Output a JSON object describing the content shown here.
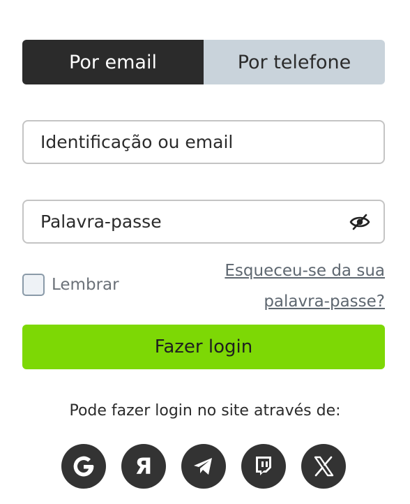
{
  "tabs": {
    "email_label": "Por email",
    "phone_label": "Por telefone"
  },
  "form": {
    "username_placeholder": "Identificação ou email",
    "password_placeholder": "Palavra-passe",
    "remember_label": "Lembrar",
    "forgot_link": "Esqueceu-se da sua palavra-passe?",
    "login_button": "Fazer login"
  },
  "social": {
    "caption": "Pode fazer login no site através de:",
    "providers": [
      "google",
      "yandex",
      "telegram",
      "twitch",
      "x"
    ]
  },
  "colors": {
    "tab_active_bg": "#2b2b2b",
    "tab_inactive_bg": "#c9d3db",
    "login_button_bg": "#7dd805",
    "social_icon_bg": "#333333"
  }
}
